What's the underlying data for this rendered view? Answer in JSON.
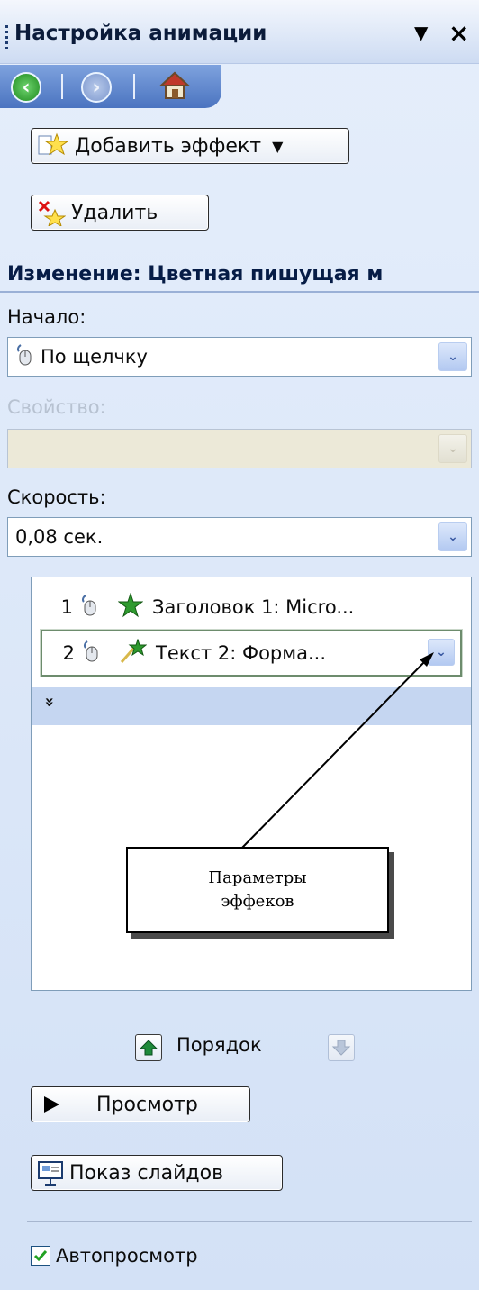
{
  "header": {
    "title": "Настройка анимации",
    "menu_glyph": "▼",
    "close_glyph": "×"
  },
  "nav": {
    "back_icon": "back-arrow-icon",
    "forward_icon": "forward-arrow-icon",
    "home_icon": "home-icon"
  },
  "actions": {
    "add_effect_label": "Добавить эффект",
    "delete_label": "Удалить"
  },
  "section": {
    "title": "Изменение: Цветная пишущая м"
  },
  "fields": {
    "start_label": "Начало:",
    "start_value": "По щелчку",
    "property_label": "Свойство:",
    "property_value": "",
    "speed_label": "Скорость:",
    "speed_value": "0,08 сек."
  },
  "effects_list": [
    {
      "num": "1",
      "text": "Заголовок 1: Micro..."
    },
    {
      "num": "2",
      "text": "Текст 2: Форма..."
    }
  ],
  "expand_glyph": "»",
  "callout": {
    "line1": "Параметры",
    "line2": "эффеков"
  },
  "order": {
    "label": "Порядок"
  },
  "buttons": {
    "play_label": "Просмотр",
    "slideshow_label": "Показ слайдов"
  },
  "autopreview": {
    "label": "Автопросмотр",
    "checked": true
  },
  "colors": {
    "panel_bg": "#d6e3f7",
    "nav_blue": "#4b74c0",
    "selected_border": "#6d8c6d"
  }
}
